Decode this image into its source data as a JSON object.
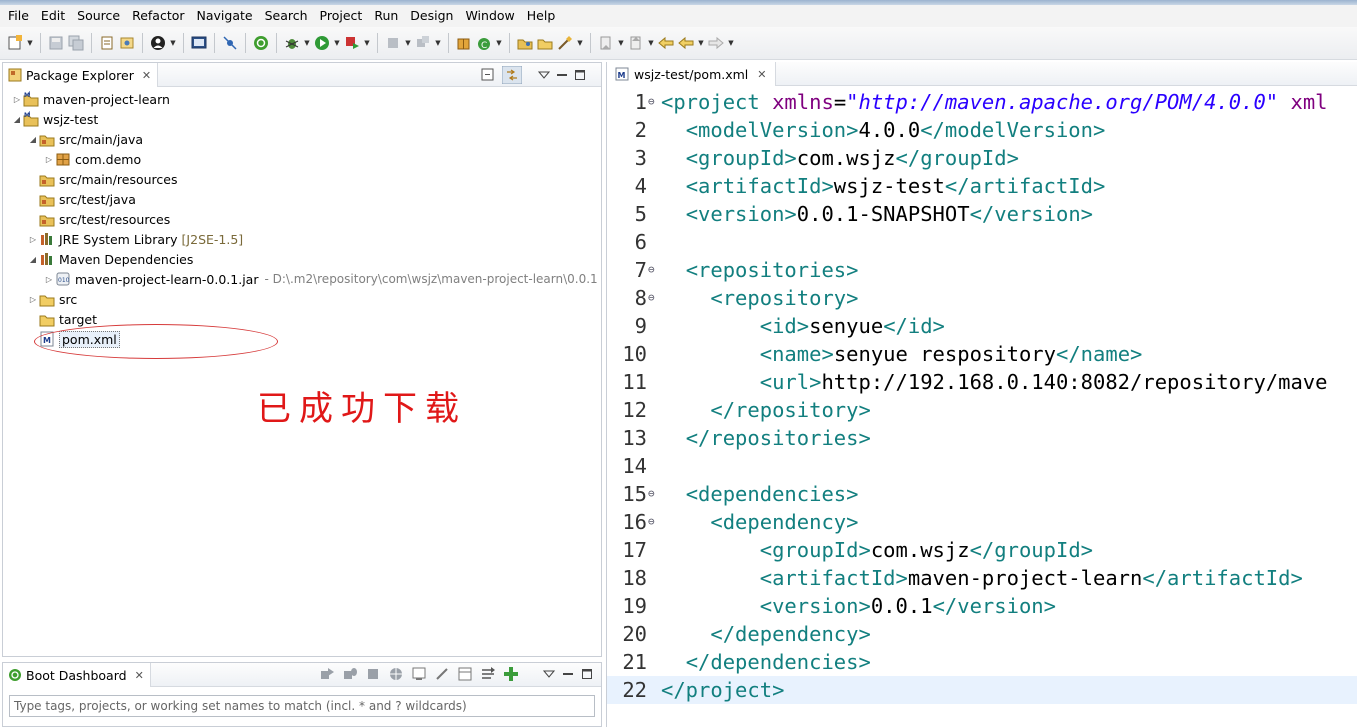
{
  "menus": [
    "File",
    "Edit",
    "Source",
    "Refactor",
    "Navigate",
    "Search",
    "Project",
    "Run",
    "Design",
    "Window",
    "Help"
  ],
  "package_explorer": {
    "title": "Package Explorer",
    "tree": [
      {
        "label": "maven-project-learn",
        "extra": "",
        "depth": 0,
        "expanded": false,
        "icon": "maven-project-icon"
      },
      {
        "label": "wsjz-test",
        "extra": "",
        "depth": 0,
        "expanded": true,
        "icon": "maven-project-icon"
      },
      {
        "label": "src/main/java",
        "extra": "",
        "depth": 1,
        "expanded": true,
        "icon": "source-folder-icon"
      },
      {
        "label": "com.demo",
        "extra": "",
        "depth": 2,
        "expanded": false,
        "icon": "package-icon"
      },
      {
        "label": "src/main/resources",
        "extra": "",
        "depth": 1,
        "expanded": null,
        "icon": "source-folder-icon"
      },
      {
        "label": "src/test/java",
        "extra": "",
        "depth": 1,
        "expanded": null,
        "icon": "source-folder-icon"
      },
      {
        "label": "src/test/resources",
        "extra": "",
        "depth": 1,
        "expanded": null,
        "icon": "source-folder-icon"
      },
      {
        "label": "JRE System Library",
        "extra": "[J2SE-1.5]",
        "depth": 1,
        "expanded": false,
        "icon": "library-icon"
      },
      {
        "label": "Maven Dependencies",
        "extra": "",
        "depth": 1,
        "expanded": true,
        "icon": "library-icon"
      },
      {
        "label": "maven-project-learn-0.0.1.jar",
        "extra": "- D:\\.m2\\repository\\com\\wsjz\\maven-project-learn\\0.0.1",
        "depth": 2,
        "expanded": false,
        "icon": "jar-icon"
      },
      {
        "label": "src",
        "extra": "",
        "depth": 1,
        "expanded": false,
        "icon": "folder-icon"
      },
      {
        "label": "target",
        "extra": "",
        "depth": 1,
        "expanded": null,
        "icon": "folder-icon"
      },
      {
        "label": "pom.xml",
        "extra": "",
        "depth": 1,
        "expanded": null,
        "icon": "xml-file-icon",
        "selected": true
      }
    ],
    "annotation": "已成功下载"
  },
  "boot_dashboard": {
    "title": "Boot Dashboard",
    "filter_placeholder": "Type tags, projects, or working set names to match (incl. * and ? wildcards)"
  },
  "editor": {
    "tab_title": "wsjz-test/pom.xml",
    "current_line": 22,
    "lines": [
      {
        "n": "1",
        "fold": true,
        "html": "<span class='tg'>&lt;project</span> <span class='at'>xmlns</span>=<span class='av'>\"http://maven.apache.org/POM/4.0.0\"</span> <span class='at'>xml</span>"
      },
      {
        "n": "2",
        "fold": false,
        "html": "  <span class='tg'>&lt;modelVersion&gt;</span>4.0.0<span class='tg'>&lt;/modelVersion&gt;</span>"
      },
      {
        "n": "3",
        "fold": false,
        "html": "  <span class='tg'>&lt;groupId&gt;</span>com.wsjz<span class='tg'>&lt;/groupId&gt;</span>"
      },
      {
        "n": "4",
        "fold": false,
        "html": "  <span class='tg'>&lt;artifactId&gt;</span>wsjz-test<span class='tg'>&lt;/artifactId&gt;</span>"
      },
      {
        "n": "5",
        "fold": false,
        "html": "  <span class='tg'>&lt;version&gt;</span>0.0.1-SNAPSHOT<span class='tg'>&lt;/version&gt;</span>"
      },
      {
        "n": "6",
        "fold": false,
        "html": ""
      },
      {
        "n": "7",
        "fold": true,
        "html": "  <span class='tg'>&lt;repositories&gt;</span>"
      },
      {
        "n": "8",
        "fold": true,
        "html": "    <span class='tg'>&lt;repository&gt;</span>"
      },
      {
        "n": "9",
        "fold": false,
        "html": "        <span class='tg'>&lt;id&gt;</span>senyue<span class='tg'>&lt;/id&gt;</span>"
      },
      {
        "n": "10",
        "fold": false,
        "html": "        <span class='tg'>&lt;name&gt;</span>senyue respository<span class='tg'>&lt;/name&gt;</span>"
      },
      {
        "n": "11",
        "fold": false,
        "html": "        <span class='tg'>&lt;url&gt;</span>http://192.168.0.140:8082/repository/mave"
      },
      {
        "n": "12",
        "fold": false,
        "html": "    <span class='tg'>&lt;/repository&gt;</span>"
      },
      {
        "n": "13",
        "fold": false,
        "html": "  <span class='tg'>&lt;/repositories&gt;</span>"
      },
      {
        "n": "14",
        "fold": false,
        "html": ""
      },
      {
        "n": "15",
        "fold": true,
        "html": "  <span class='tg'>&lt;dependencies&gt;</span>"
      },
      {
        "n": "16",
        "fold": true,
        "html": "    <span class='tg'>&lt;dependency&gt;</span>"
      },
      {
        "n": "17",
        "fold": false,
        "html": "        <span class='tg'>&lt;groupId&gt;</span>com.wsjz<span class='tg'>&lt;/groupId&gt;</span>"
      },
      {
        "n": "18",
        "fold": false,
        "html": "        <span class='tg'>&lt;artifactId&gt;</span>maven-project-learn<span class='tg'>&lt;/artifactId&gt;</span>"
      },
      {
        "n": "19",
        "fold": false,
        "html": "        <span class='tg'>&lt;version&gt;</span>0.0.1<span class='tg'>&lt;/version&gt;</span>"
      },
      {
        "n": "20",
        "fold": false,
        "html": "    <span class='tg'>&lt;/dependency&gt;</span>"
      },
      {
        "n": "21",
        "fold": false,
        "html": "  <span class='tg'>&lt;/dependencies&gt;</span>"
      },
      {
        "n": "22",
        "fold": false,
        "html": "<span class='tg'>&lt;/project&gt;</span>"
      }
    ]
  }
}
